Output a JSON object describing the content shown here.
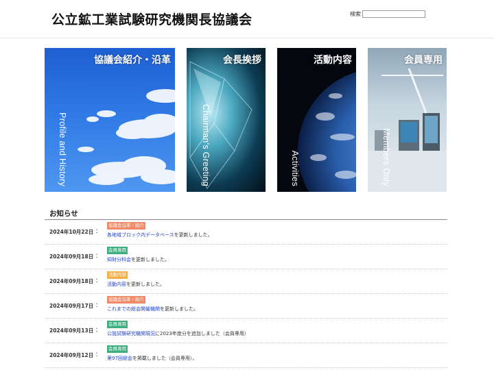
{
  "header": {
    "title": "公立鉱工業試験研究機関長協議会",
    "search_label": "検索",
    "search_value": "",
    "search_placeholder": ""
  },
  "tiles": [
    {
      "title": "協議会紹介・沿革",
      "subtitle": "Profile and History"
    },
    {
      "title": "会長挨拶",
      "subtitle": "Chairman's Greeting"
    },
    {
      "title": "活動内容",
      "subtitle": "Activities"
    },
    {
      "title": "会員専用",
      "subtitle": "Members Only"
    }
  ],
  "news": {
    "heading": "お知らせ",
    "items": [
      {
        "date": "2024年10月22日",
        "colon": "：",
        "tag": "協議会沿革・紹介",
        "tag_color": "#f08a67",
        "link": "各地域ブロック内データベース",
        "rest": "を更新しました。"
      },
      {
        "date": "2024年09月18日",
        "colon": "：",
        "tag": "会員専用",
        "tag_color": "#3cae7f",
        "link": "知財分科会",
        "rest": "を更新しました。"
      },
      {
        "date": "2024年09月18日",
        "colon": "：",
        "tag": "活動内容",
        "tag_color": "#f3ae45",
        "link": "活動内容",
        "rest": "を更新しました。"
      },
      {
        "date": "2024年09月17日",
        "colon": "：",
        "tag": "協議会沿革・紹介",
        "tag_color": "#f08a67",
        "link": "これまでの総会開催機関",
        "rest": "を更新しました。"
      },
      {
        "date": "2024年09月13日",
        "colon": "：",
        "tag": "会員専用",
        "tag_color": "#3cae7f",
        "link": "公設試験研究機関現況",
        "rest": "に2023年度分を追加しました（会員専用）"
      },
      {
        "date": "2024年09月12日",
        "colon": "：",
        "tag": "会員専用",
        "tag_color": "#3cae7f",
        "link": "第97回総会",
        "rest": "を掲載しました（会員専用）。"
      }
    ]
  }
}
